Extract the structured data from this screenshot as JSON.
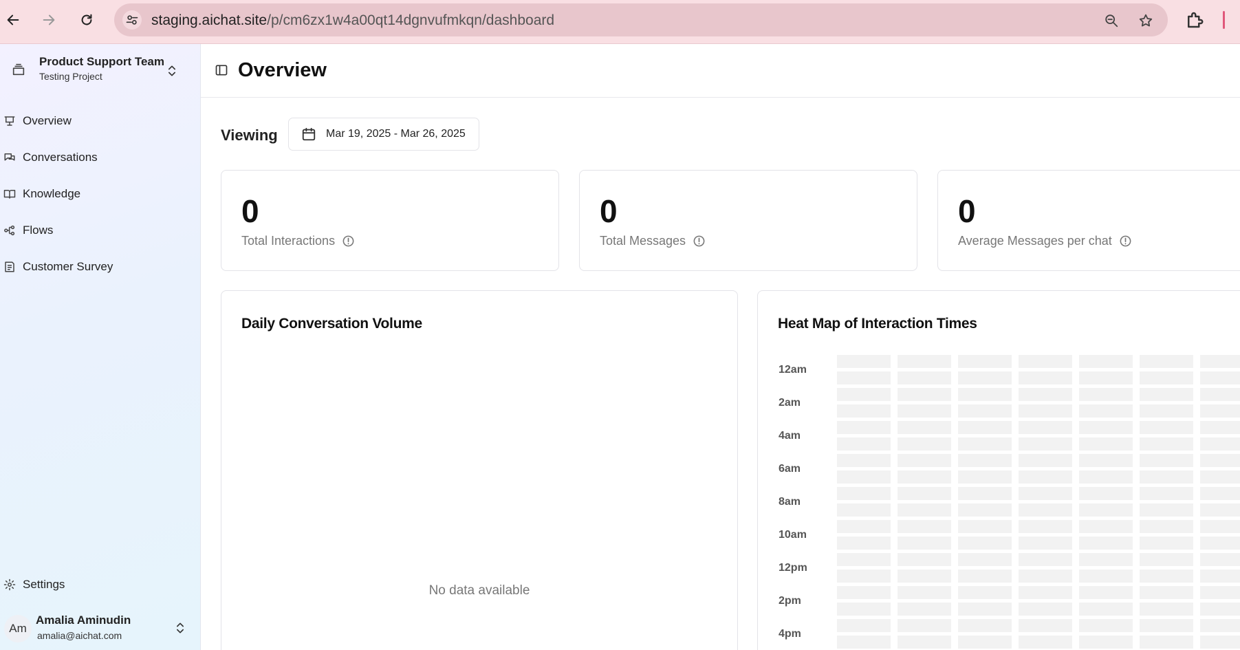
{
  "browser": {
    "url_host": "staging.aichat.site",
    "url_path": "/p/cm6zx1w4a00qt14dgnvufmkqn/dashboard"
  },
  "sidebar": {
    "team_name": "Product Support Team",
    "project_name": "Testing Project",
    "items": [
      {
        "label": "Overview",
        "icon": "presentation-icon"
      },
      {
        "label": "Conversations",
        "icon": "chat-icon"
      },
      {
        "label": "Knowledge",
        "icon": "book-icon"
      },
      {
        "label": "Flows",
        "icon": "flow-icon"
      },
      {
        "label": "Customer Survey",
        "icon": "survey-icon"
      }
    ],
    "settings_label": "Settings",
    "user": {
      "initials": "Am",
      "name": "Amalia Aminudin",
      "email": "amalia@aichat.com"
    }
  },
  "header": {
    "title": "Overview"
  },
  "filters": {
    "viewing_label": "Viewing",
    "date_range": "Mar 19, 2025 - Mar 26, 2025"
  },
  "stats": [
    {
      "value": "0",
      "label": "Total Interactions"
    },
    {
      "value": "0",
      "label": "Total Messages"
    },
    {
      "value": "0",
      "label": "Average Messages per chat"
    }
  ],
  "daily_volume": {
    "title": "Daily Conversation Volume",
    "empty_text": "No data available"
  },
  "heatmap": {
    "title": "Heat Map of Interaction Times",
    "hour_labels": [
      "12am",
      "2am",
      "4am",
      "6am",
      "8am",
      "10am",
      "12pm",
      "2pm",
      "4pm"
    ],
    "cell_color": "#f2f2f2"
  },
  "colors": {
    "browser_bar": "#f9dfe3",
    "omnibox": "#e8c6cc",
    "accent_line": "#e0577a"
  }
}
